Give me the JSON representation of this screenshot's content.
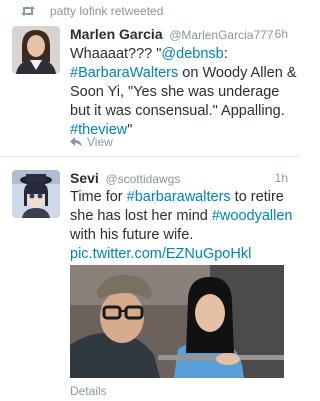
{
  "retweet_context": {
    "text": "patty lofink retweeted",
    "icon": "retweet-icon"
  },
  "tweets": [
    {
      "fullname": "Marlen Garcia",
      "username": "@MarlenGarcia777",
      "time": "6h",
      "lines": [
        [
          {
            "t": "Whaaaat??? \"",
            "link": false
          },
          {
            "t": "@debnsb",
            "link": true
          },
          {
            "t": ":",
            "link": false
          }
        ],
        [
          {
            "t": "#BarbaraWalters",
            "link": true
          },
          {
            "t": " on Woody Allen &",
            "link": false
          }
        ],
        [
          {
            "t": "Soon Yi, \"Yes she was underage",
            "link": false
          }
        ],
        [
          {
            "t": "but it was consensual.\"  Appalling.",
            "link": false
          }
        ],
        [
          {
            "t": "#theview",
            "link": true
          },
          {
            "t": "\"",
            "link": false
          }
        ]
      ],
      "action": {
        "label": "View",
        "icon": "reply-icon"
      }
    },
    {
      "fullname": "Sevi",
      "username": "@scottidawgs",
      "time": "1h",
      "lines": [
        [
          {
            "t": "Time for ",
            "link": false
          },
          {
            "t": "#barbarawalters",
            "link": true
          },
          {
            "t": " to retire",
            "link": false
          }
        ],
        [
          {
            "t": "she has lost her mind ",
            "link": false
          },
          {
            "t": "#woodyallen",
            "link": true
          }
        ],
        [
          {
            "t": "with his future wife.",
            "link": false
          }
        ],
        [
          {
            "t": "pic.twitter.com/EZNuGpoHkl",
            "link": true
          }
        ]
      ],
      "media": {
        "description_icon": "photo"
      },
      "action": {
        "label": "Details"
      }
    }
  ],
  "colors": {
    "link": "#0084b4",
    "meta": "#8899a6",
    "text": "#292f33"
  }
}
